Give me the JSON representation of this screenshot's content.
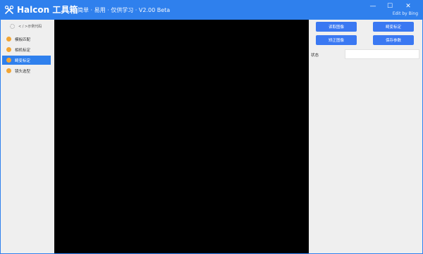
{
  "titlebar": {
    "title": "Halcon 工具箱",
    "subtitle": "简单 · 易用 · 仅供学习 · V2.00 Beta",
    "credit": "Edit by Bing",
    "minimize_glyph": "—",
    "maximize_glyph": "☐",
    "close_glyph": "✕"
  },
  "sidebar": {
    "header": "< / >示例代码",
    "items": [
      {
        "label": "模板匹配",
        "active": false
      },
      {
        "label": "相机标定",
        "active": false
      },
      {
        "label": "畸变标定",
        "active": true
      },
      {
        "label": "镜头选型",
        "active": false
      }
    ]
  },
  "panel": {
    "read_image": "读取图像",
    "distortion_calibration": "畸变标定",
    "correct_image": "矫正图像",
    "save_params": "保存参数",
    "status_label": "状态",
    "status_value": ""
  },
  "colors": {
    "accent": "#2f80ed",
    "button": "#3a78f2",
    "nav_dot": "#f2a534",
    "canvas": "#000000",
    "background": "#efefef"
  }
}
